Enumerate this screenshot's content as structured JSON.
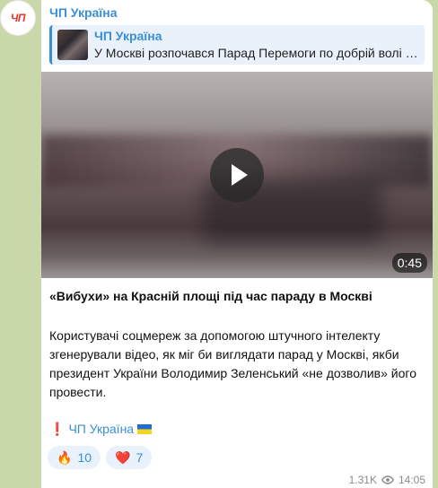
{
  "channel": {
    "avatar_text": "ЧП",
    "name": "ЧП Україна"
  },
  "reply": {
    "sender": "ЧП Україна",
    "text": "У Москві розпочався Парад Перемоги по добрій волі …"
  },
  "video": {
    "duration": "0:45"
  },
  "post": {
    "headline": "«Вибухи» на Красній площі під час параду в Москві",
    "body": "Користувачі соцмереж за допомогою штучного інтелекту згенерували відео, як міг би виглядати парад у Москві, якби президент України Володимир Зеленський «не дозволив» його провести.",
    "signature": "ЧП Україна",
    "signature_icon": "exclamation-icon"
  },
  "reactions": [
    {
      "emoji": "🔥",
      "count": "10"
    },
    {
      "emoji": "❤️",
      "count": "7"
    }
  ],
  "meta": {
    "views": "1.31K",
    "time": "14:05"
  },
  "colors": {
    "accent": "#3a8ed6",
    "chat_background": "#c8d8a8",
    "avatar_text": "#e8362e"
  }
}
